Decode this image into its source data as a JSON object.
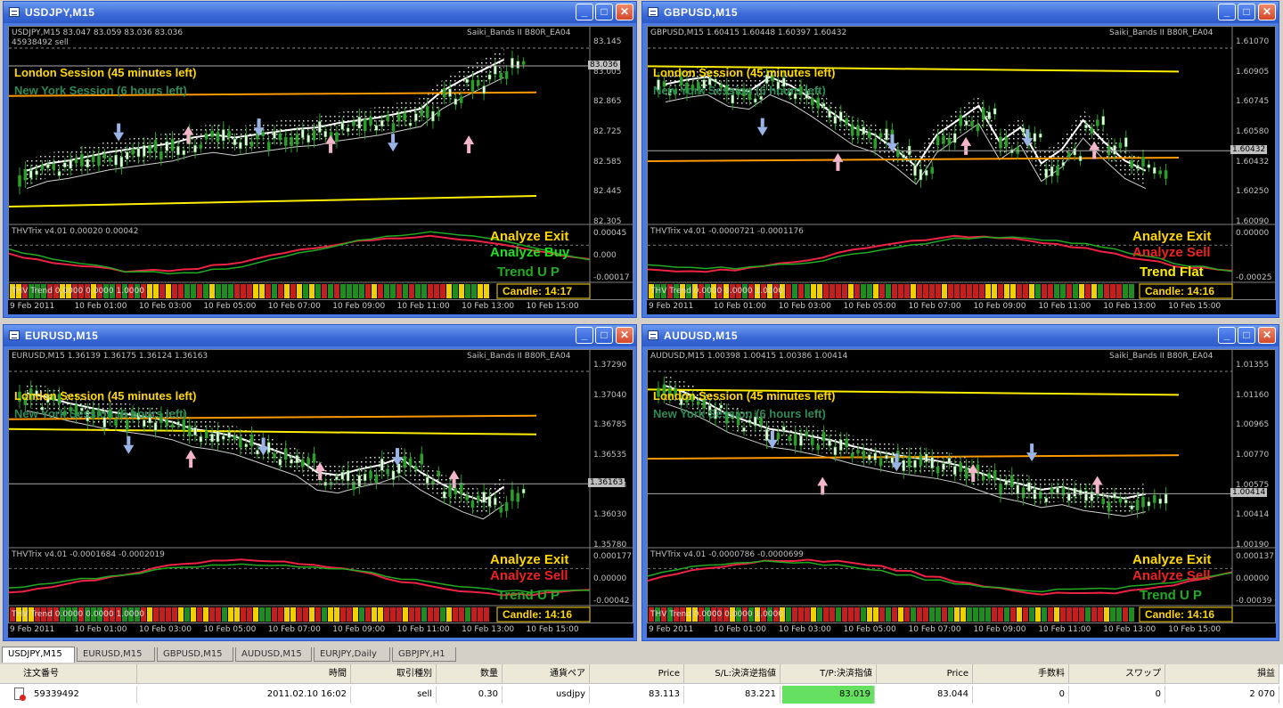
{
  "windows": [
    {
      "title": "USDJPY,M15",
      "header": "USDJPY,M15  83.047 83.059 83.036 83.036",
      "band_label": "Saiki_Bands II B80R_EA04",
      "sub_label": "45938492 sell",
      "session1": "London Session (45 minutes left)",
      "session2": "New York Session (6 hours left)",
      "prices": [
        "83.145",
        "83.005",
        "82.865",
        "82.725",
        "82.585",
        "82.445",
        "82.305"
      ],
      "price_tag": "83.036",
      "ind_header": "THVTrix v4.01 0.00020 0.00042",
      "ind_prices": [
        "0.00045",
        "0.000",
        "-0.00017"
      ],
      "ind1": "Analyze Exit",
      "ind2": "Analyze Buy",
      "ind2_color": "#22dd22",
      "ind3": "Trend U P",
      "ind3_color": "#22aa22",
      "bar_label": "THV Trend 0.0000 0.0000 1.0000",
      "candle": "Candle: 14:17",
      "times": [
        "9 Feb 2011",
        "10 Feb 01:00",
        "10 Feb 03:00",
        "10 Feb 05:00",
        "10 Feb 07:00",
        "10 Feb 09:00",
        "10 Feb 11:00",
        "10 Feb 13:00",
        "10 Feb 15:00"
      ]
    },
    {
      "title": "GBPUSD,M15",
      "header": "GBPUSD,M15  1.60415 1.60448 1.60397 1.60432",
      "band_label": "Saiki_Bands II B80R_EA04",
      "sub_label": "",
      "session1": "London Session (45 minutes left)",
      "session2": "New York Session (6 hours left)",
      "prices": [
        "1.61070",
        "1.60905",
        "1.60745",
        "1.60580",
        "1.60432",
        "1.60250",
        "1.60090"
      ],
      "price_tag": "1.60432",
      "ind_header": "THVTrix v4.01 -0.0000721 -0.0001176",
      "ind_prices": [
        "0.00000",
        "-0.00025"
      ],
      "ind1": "Analyze Exit",
      "ind2": "Analyze Sell",
      "ind2_color": "#ee2222",
      "ind3": "Trend Flat",
      "ind3_color": "#ffee00",
      "bar_label": "THV Trend 0.0000 0.0000 1.0000",
      "candle": "Candle: 14:16",
      "times": [
        "9 Feb 2011",
        "10 Feb 01:00",
        "10 Feb 03:00",
        "10 Feb 05:00",
        "10 Feb 07:00",
        "10 Feb 09:00",
        "10 Feb 11:00",
        "10 Feb 13:00",
        "10 Feb 15:00"
      ]
    },
    {
      "title": "EURUSD,M15",
      "header": "EURUSD,M15  1.36139 1.36175 1.36124 1.36163",
      "band_label": "Saiki_Bands II B80R_EA04",
      "sub_label": "",
      "session1": "London Session (45 minutes left)",
      "session2": "New York Session (6 hours left)",
      "prices": [
        "1.37290",
        "1.37040",
        "1.36785",
        "1.36535",
        "1.36163",
        "1.36030",
        "1.35780"
      ],
      "price_tag": "1.36163",
      "ind_header": "THVTrix v4.01 -0.0001684 -0.0002019",
      "ind_prices": [
        "0.000177",
        "0.00000",
        "-0.00042"
      ],
      "ind1": "Analyze Exit",
      "ind2": "Analyze Sell",
      "ind2_color": "#ee2222",
      "ind3": "Trend U P",
      "ind3_color": "#22aa22",
      "bar_label": "THV Trend 0.0000 0.0000 1.0000",
      "candle": "Candle: 14:16",
      "times": [
        "9 Feb 2011",
        "10 Feb 01:00",
        "10 Feb 03:00",
        "10 Feb 05:00",
        "10 Feb 07:00",
        "10 Feb 09:00",
        "10 Feb 11:00",
        "10 Feb 13:00",
        "10 Feb 15:00"
      ]
    },
    {
      "title": "AUDUSD,M15",
      "header": "AUDUSD,M15  1.00398 1.00415 1.00386 1.00414",
      "band_label": "Saiki_Bands II B80R_EA04",
      "sub_label": "",
      "session1": "London Session (45 minutes left)",
      "session2": "New York Session (6 hours left)",
      "prices": [
        "1.01355",
        "1.01160",
        "1.00965",
        "1.00770",
        "1.00575",
        "1.00414",
        "1.00190"
      ],
      "price_tag": "1.00414",
      "ind_header": "THVTrix v4.01 -0.0000786 -0.0000699",
      "ind_prices": [
        "0.000137",
        "0.00000",
        "-0.00039"
      ],
      "ind1": "Analyze Exit",
      "ind2": "Analyze Sell",
      "ind2_color": "#ee2222",
      "ind3": "Trend U P",
      "ind3_color": "#22aa22",
      "bar_label": "THV Trend 0.0000 0.0000 1.0000",
      "candle": "Candle: 14:16",
      "times": [
        "9 Feb 2011",
        "10 Feb 01:00",
        "10 Feb 03:00",
        "10 Feb 05:00",
        "10 Feb 07:00",
        "10 Feb 09:00",
        "10 Feb 11:00",
        "10 Feb 13:00",
        "10 Feb 15:00"
      ]
    }
  ],
  "tabs": [
    "USDJPY,M15",
    "EURUSD,M15",
    "GBPUSD,M15",
    "AUDUSD,M15",
    "EURJPY,Daily",
    "GBPJPY,H1"
  ],
  "table": {
    "headers": [
      "注文番号",
      "時間",
      "取引種別",
      "数量",
      "通貨ペア",
      "Price",
      "S/L:決済逆指値",
      "T/P:決済指値",
      "Price",
      "手数料",
      "スワップ",
      "損益"
    ],
    "row": [
      "59339492",
      "2011.02.10 16:02",
      "sell",
      "0.30",
      "usdjpy",
      "83.113",
      "83.221",
      "83.019",
      "83.044",
      "0",
      "0",
      "2 070"
    ]
  },
  "colors": {
    "title_active": "#3a68d6",
    "tp_highlight": "#66e060",
    "session_london": "#ffd700",
    "session_ny": "#2e8b57"
  }
}
